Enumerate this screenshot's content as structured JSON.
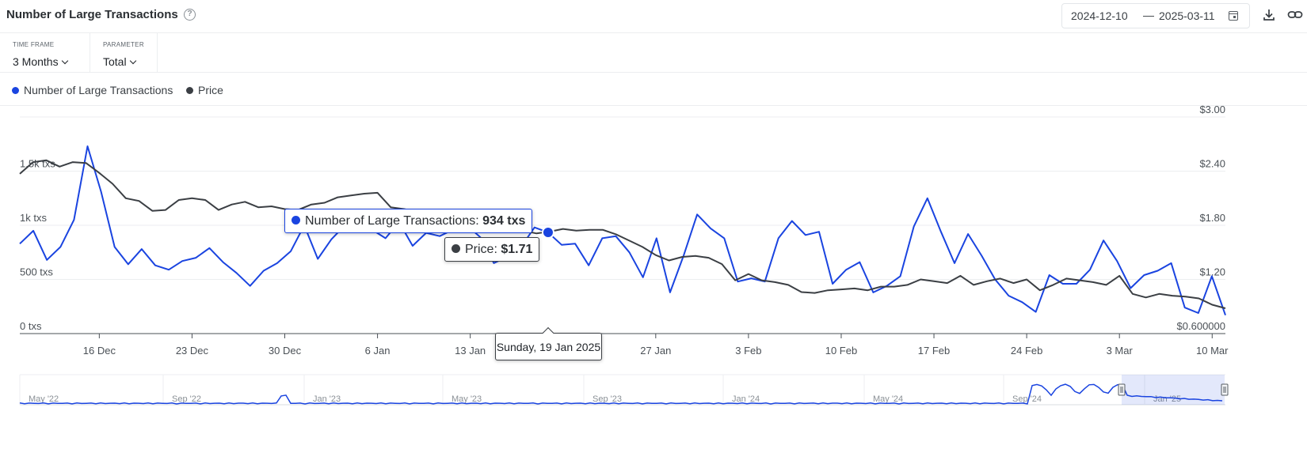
{
  "header": {
    "title": "Number of Large Transactions",
    "help_icon": "help-icon",
    "date_from": "2024-12-10",
    "date_sep": "—",
    "date_to": "2025-03-11",
    "calendar_icon": "calendar-icon",
    "download_icon": "download-icon",
    "link_icon": "link-icon"
  },
  "controls": {
    "timeframe_label": "TIME FRAME",
    "timeframe_value": "3 Months",
    "parameter_label": "PARAMETER",
    "parameter_value": "Total"
  },
  "legend": [
    {
      "label": "Number of Large Transactions",
      "color": "#1a44e0"
    },
    {
      "label": "Price",
      "color": "#3b3f44"
    }
  ],
  "tooltip": {
    "tx_label": "Number of Large Transactions: ",
    "tx_value": "934 txs",
    "price_label": "Price: ",
    "price_value": "$1.71",
    "date": "Sunday, 19 Jan 2025"
  },
  "chart_data": {
    "type": "line",
    "x_start": "2024-12-10",
    "x_end": "2025-03-11",
    "x_ticks": [
      "16 Dec",
      "23 Dec",
      "30 Dec",
      "6 Jan",
      "13 Jan",
      "20 Jan",
      "27 Jan",
      "3 Feb",
      "10 Feb",
      "17 Feb",
      "24 Feb",
      "3 Mar",
      "10 Mar"
    ],
    "y_left_ticks": [
      "0 txs",
      "500 txs",
      "1k txs",
      "1.5k txs"
    ],
    "y_right_ticks": [
      "$0.600000",
      "$1.20",
      "$1.80",
      "$2.40",
      "$3.00"
    ],
    "y_left_range": [
      0,
      2000
    ],
    "y_right_range": [
      0.6,
      3.0
    ],
    "grid": true,
    "series": [
      {
        "name": "Number of Large Transactions",
        "color": "#1a44e0",
        "axis": "left",
        "values": [
          830,
          950,
          680,
          800,
          1050,
          1730,
          1310,
          800,
          640,
          780,
          630,
          590,
          670,
          700,
          790,
          660,
          560,
          440,
          580,
          650,
          760,
          1000,
          690,
          870,
          1000,
          1080,
          960,
          880,
          1030,
          810,
          930,
          900,
          960,
          1000,
          890,
          650,
          710,
          800,
          980,
          934,
          820,
          830,
          630,
          880,
          900,
          750,
          520,
          880,
          380,
          720,
          1100,
          970,
          880,
          480,
          510,
          480,
          880,
          1040,
          910,
          940,
          460,
          590,
          660,
          380,
          440,
          530,
          990,
          1250,
          940,
          650,
          920,
          720,
          500,
          350,
          290,
          200,
          540,
          460,
          460,
          590,
          860,
          670,
          420,
          540,
          580,
          650,
          240,
          190,
          530,
          170
        ]
      },
      {
        "name": "Price",
        "color": "#3b3f44",
        "axis": "right",
        "values": [
          2.37,
          2.5,
          2.52,
          2.45,
          2.5,
          2.49,
          2.38,
          2.26,
          2.1,
          2.07,
          1.96,
          1.97,
          2.08,
          2.1,
          2.08,
          1.97,
          2.03,
          2.06,
          2.0,
          2.01,
          1.98,
          1.97,
          2.03,
          2.05,
          2.11,
          2.13,
          2.15,
          2.16,
          2.0,
          1.98,
          1.95,
          1.89,
          1.85,
          1.89,
          1.88,
          1.86,
          1.83,
          1.82,
          1.74,
          1.71,
          1.73,
          1.76,
          1.74,
          1.75,
          1.75,
          1.7,
          1.63,
          1.56,
          1.47,
          1.41,
          1.45,
          1.46,
          1.44,
          1.37,
          1.19,
          1.26,
          1.19,
          1.17,
          1.14,
          1.06,
          1.05,
          1.08,
          1.09,
          1.1,
          1.08,
          1.12,
          1.12,
          1.14,
          1.2,
          1.18,
          1.16,
          1.24,
          1.14,
          1.18,
          1.21,
          1.16,
          1.2,
          1.08,
          1.14,
          1.21,
          1.19,
          1.17,
          1.14,
          1.24,
          1.04,
          1.0,
          1.04,
          1.02,
          1.01,
          0.99,
          0.92,
          0.88
        ]
      }
    ],
    "navigator_labels": [
      "May '22",
      "Sep '22",
      "Jan '23",
      "May '23",
      "Sep '23",
      "Jan '24",
      "May '24",
      "Sep '24",
      "Jan '25"
    ]
  }
}
